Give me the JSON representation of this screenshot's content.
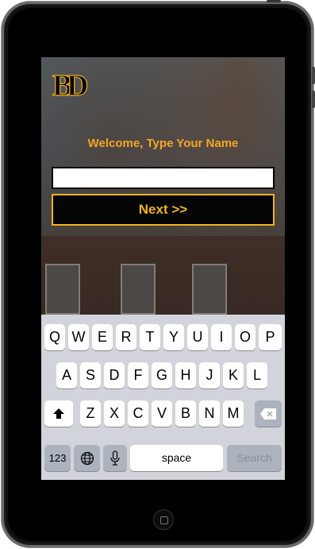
{
  "app": {
    "welcome_text": "Welcome, Type Your Name",
    "name_input_value": "",
    "next_label": "Next >>",
    "logo_text": "BD",
    "accent_color": "#f2b21f"
  },
  "keyboard": {
    "row1": [
      "Q",
      "W",
      "E",
      "R",
      "T",
      "Y",
      "U",
      "I",
      "O",
      "P"
    ],
    "row2": [
      "A",
      "S",
      "D",
      "F",
      "G",
      "H",
      "J",
      "K",
      "L"
    ],
    "row3": [
      "Z",
      "X",
      "C",
      "V",
      "B",
      "N",
      "M"
    ],
    "numbers_label": "123",
    "space_label": "space",
    "search_label": "Search",
    "icons": {
      "shift": "shift-arrow-icon",
      "delete": "backspace-icon",
      "globe": "globe-icon",
      "mic": "microphone-icon"
    }
  }
}
